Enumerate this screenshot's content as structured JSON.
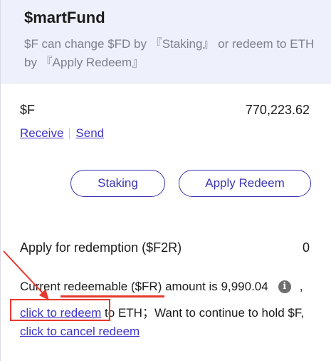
{
  "header": {
    "title": "$martFund",
    "subtitle": "$F can change $FD by 『Staking』 or redeem to ETH by 『Apply Redeem』"
  },
  "balance": {
    "symbol": "$F",
    "amount": "770,223.62"
  },
  "links": {
    "receive": "Receive",
    "send": "Send"
  },
  "buttons": {
    "staking": "Staking",
    "apply_redeem": "Apply Redeem"
  },
  "redemption": {
    "label": "Apply for redemption ($F2R)",
    "value": "0"
  },
  "info": {
    "prefix": "Current ",
    "highlight": "redeemable ($FR)",
    "suffix": " amount is 9,990.04",
    "comma": ",",
    "info_icon": "info-icon",
    "click_to_redeem": "click to redeem",
    "to_eth_text": " to ETH；Want to continue to hold $F,",
    "click_to_cancel": "click to cancel redeem"
  },
  "annotation": {
    "color": "#e63a2e"
  }
}
